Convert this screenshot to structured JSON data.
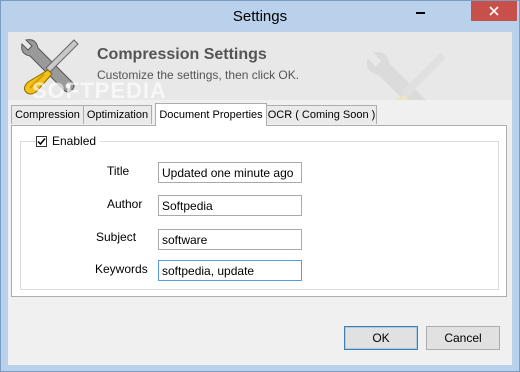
{
  "window": {
    "title": "Settings"
  },
  "header": {
    "title": "Compression Settings",
    "subtitle": "Customize the settings, then click OK.",
    "watermark": "SOFTPEDIA"
  },
  "tabs": [
    {
      "label": "Compression",
      "active": false
    },
    {
      "label": "Optimization",
      "active": false
    },
    {
      "label": "Document Properties",
      "active": true
    },
    {
      "label": "OCR ( Coming Soon )",
      "active": false
    }
  ],
  "document_properties": {
    "enabled_label": "Enabled",
    "enabled_checked": true,
    "fields": {
      "title": {
        "label": "Title",
        "value": "Updated one minute ago"
      },
      "author": {
        "label": "Author",
        "value": "Softpedia"
      },
      "subject": {
        "label": "Subject",
        "value": "software"
      },
      "keywords": {
        "label": "Keywords",
        "value": "softpedia, update"
      }
    }
  },
  "buttons": {
    "ok": "OK",
    "cancel": "Cancel"
  },
  "icons": {
    "minimize": "minimize-icon",
    "close": "close-icon",
    "tools": "tools-icon",
    "checkmark": "checkmark-icon"
  },
  "colors": {
    "close_button": "#c7504a",
    "title_bar": "#b9d1ea",
    "focus_border": "#569de5"
  }
}
